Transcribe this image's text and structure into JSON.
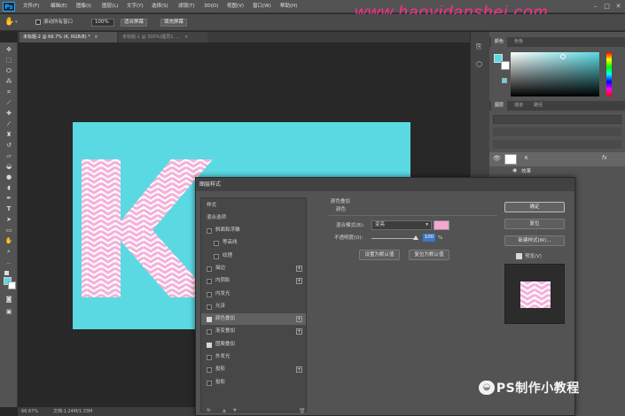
{
  "app": {
    "logo": "Ps"
  },
  "menu": [
    "文件(F)",
    "编辑(E)",
    "图像(I)",
    "图层(L)",
    "文字(Y)",
    "选择(S)",
    "滤镜(T)",
    "3D(D)",
    "视图(V)",
    "窗口(W)",
    "帮助(H)"
  ],
  "watermark": "www.haoyidanshej.com",
  "options": {
    "scroll_all_label": "滚动所有窗口",
    "zoom_value": "100%",
    "fit_screen": "适合屏幕",
    "fill_screen": "填充屏幕"
  },
  "tabs": [
    {
      "label": "未标题-2 @ 66.7% (K, RGB/8) *",
      "active": true
    },
    {
      "label": "未标题-1 @ 300%(图层1, ...",
      "active": false
    }
  ],
  "canvas": {
    "bg_color": "#5ad9e3",
    "letter": "K",
    "pattern_color": "#f3b3db"
  },
  "status": {
    "zoom": "66.67%",
    "doc_info": "文档:1.24M/1.33M"
  },
  "color_panel": {
    "tabs": [
      "颜色",
      "色板"
    ]
  },
  "layers_panel": {
    "tabs": [
      "图层",
      "通道",
      "路径"
    ],
    "layer_name": "K",
    "effects_label": "效果",
    "fx": "fx"
  },
  "dialog": {
    "title": "图层样式",
    "styles_header": "样式",
    "blend_options": "混合选项",
    "items": [
      {
        "label": "斜面和浮雕",
        "checked": false,
        "indent": false,
        "plus": false
      },
      {
        "label": "等高线",
        "checked": false,
        "indent": true,
        "plus": false
      },
      {
        "label": "纹理",
        "checked": false,
        "indent": true,
        "plus": false
      },
      {
        "label": "描边",
        "checked": false,
        "indent": false,
        "plus": true
      },
      {
        "label": "内阴影",
        "checked": false,
        "indent": false,
        "plus": true
      },
      {
        "label": "内发光",
        "checked": false,
        "indent": false,
        "plus": false
      },
      {
        "label": "光泽",
        "checked": false,
        "indent": false,
        "plus": false
      },
      {
        "label": "颜色叠加",
        "checked": true,
        "indent": false,
        "plus": true,
        "selected": true
      },
      {
        "label": "渐变叠加",
        "checked": false,
        "indent": false,
        "plus": true
      },
      {
        "label": "图案叠加",
        "checked": true,
        "indent": false,
        "plus": false
      },
      {
        "label": "外发光",
        "checked": false,
        "indent": false,
        "plus": false
      },
      {
        "label": "投影",
        "checked": false,
        "indent": false,
        "plus": true
      },
      {
        "label": "投影",
        "checked": false,
        "indent": false,
        "plus": false
      }
    ],
    "section_title": "颜色叠加",
    "section_sub": "颜色",
    "blend_mode_label": "混合模式(B):",
    "blend_mode_value": "变亮",
    "overlay_color": "#f4a6d3",
    "opacity_label": "不透明度(O):",
    "opacity_value": "100",
    "opacity_unit": "%",
    "opacity_level": 1.0,
    "set_default": "设置为默认值",
    "reset_default": "复位为默认值",
    "ok": "确定",
    "cancel": "复位",
    "new_style": "新建样式(W)...",
    "preview_label": "预览(V)",
    "fx_icon": "fx"
  },
  "brand": "PS制作小教程"
}
